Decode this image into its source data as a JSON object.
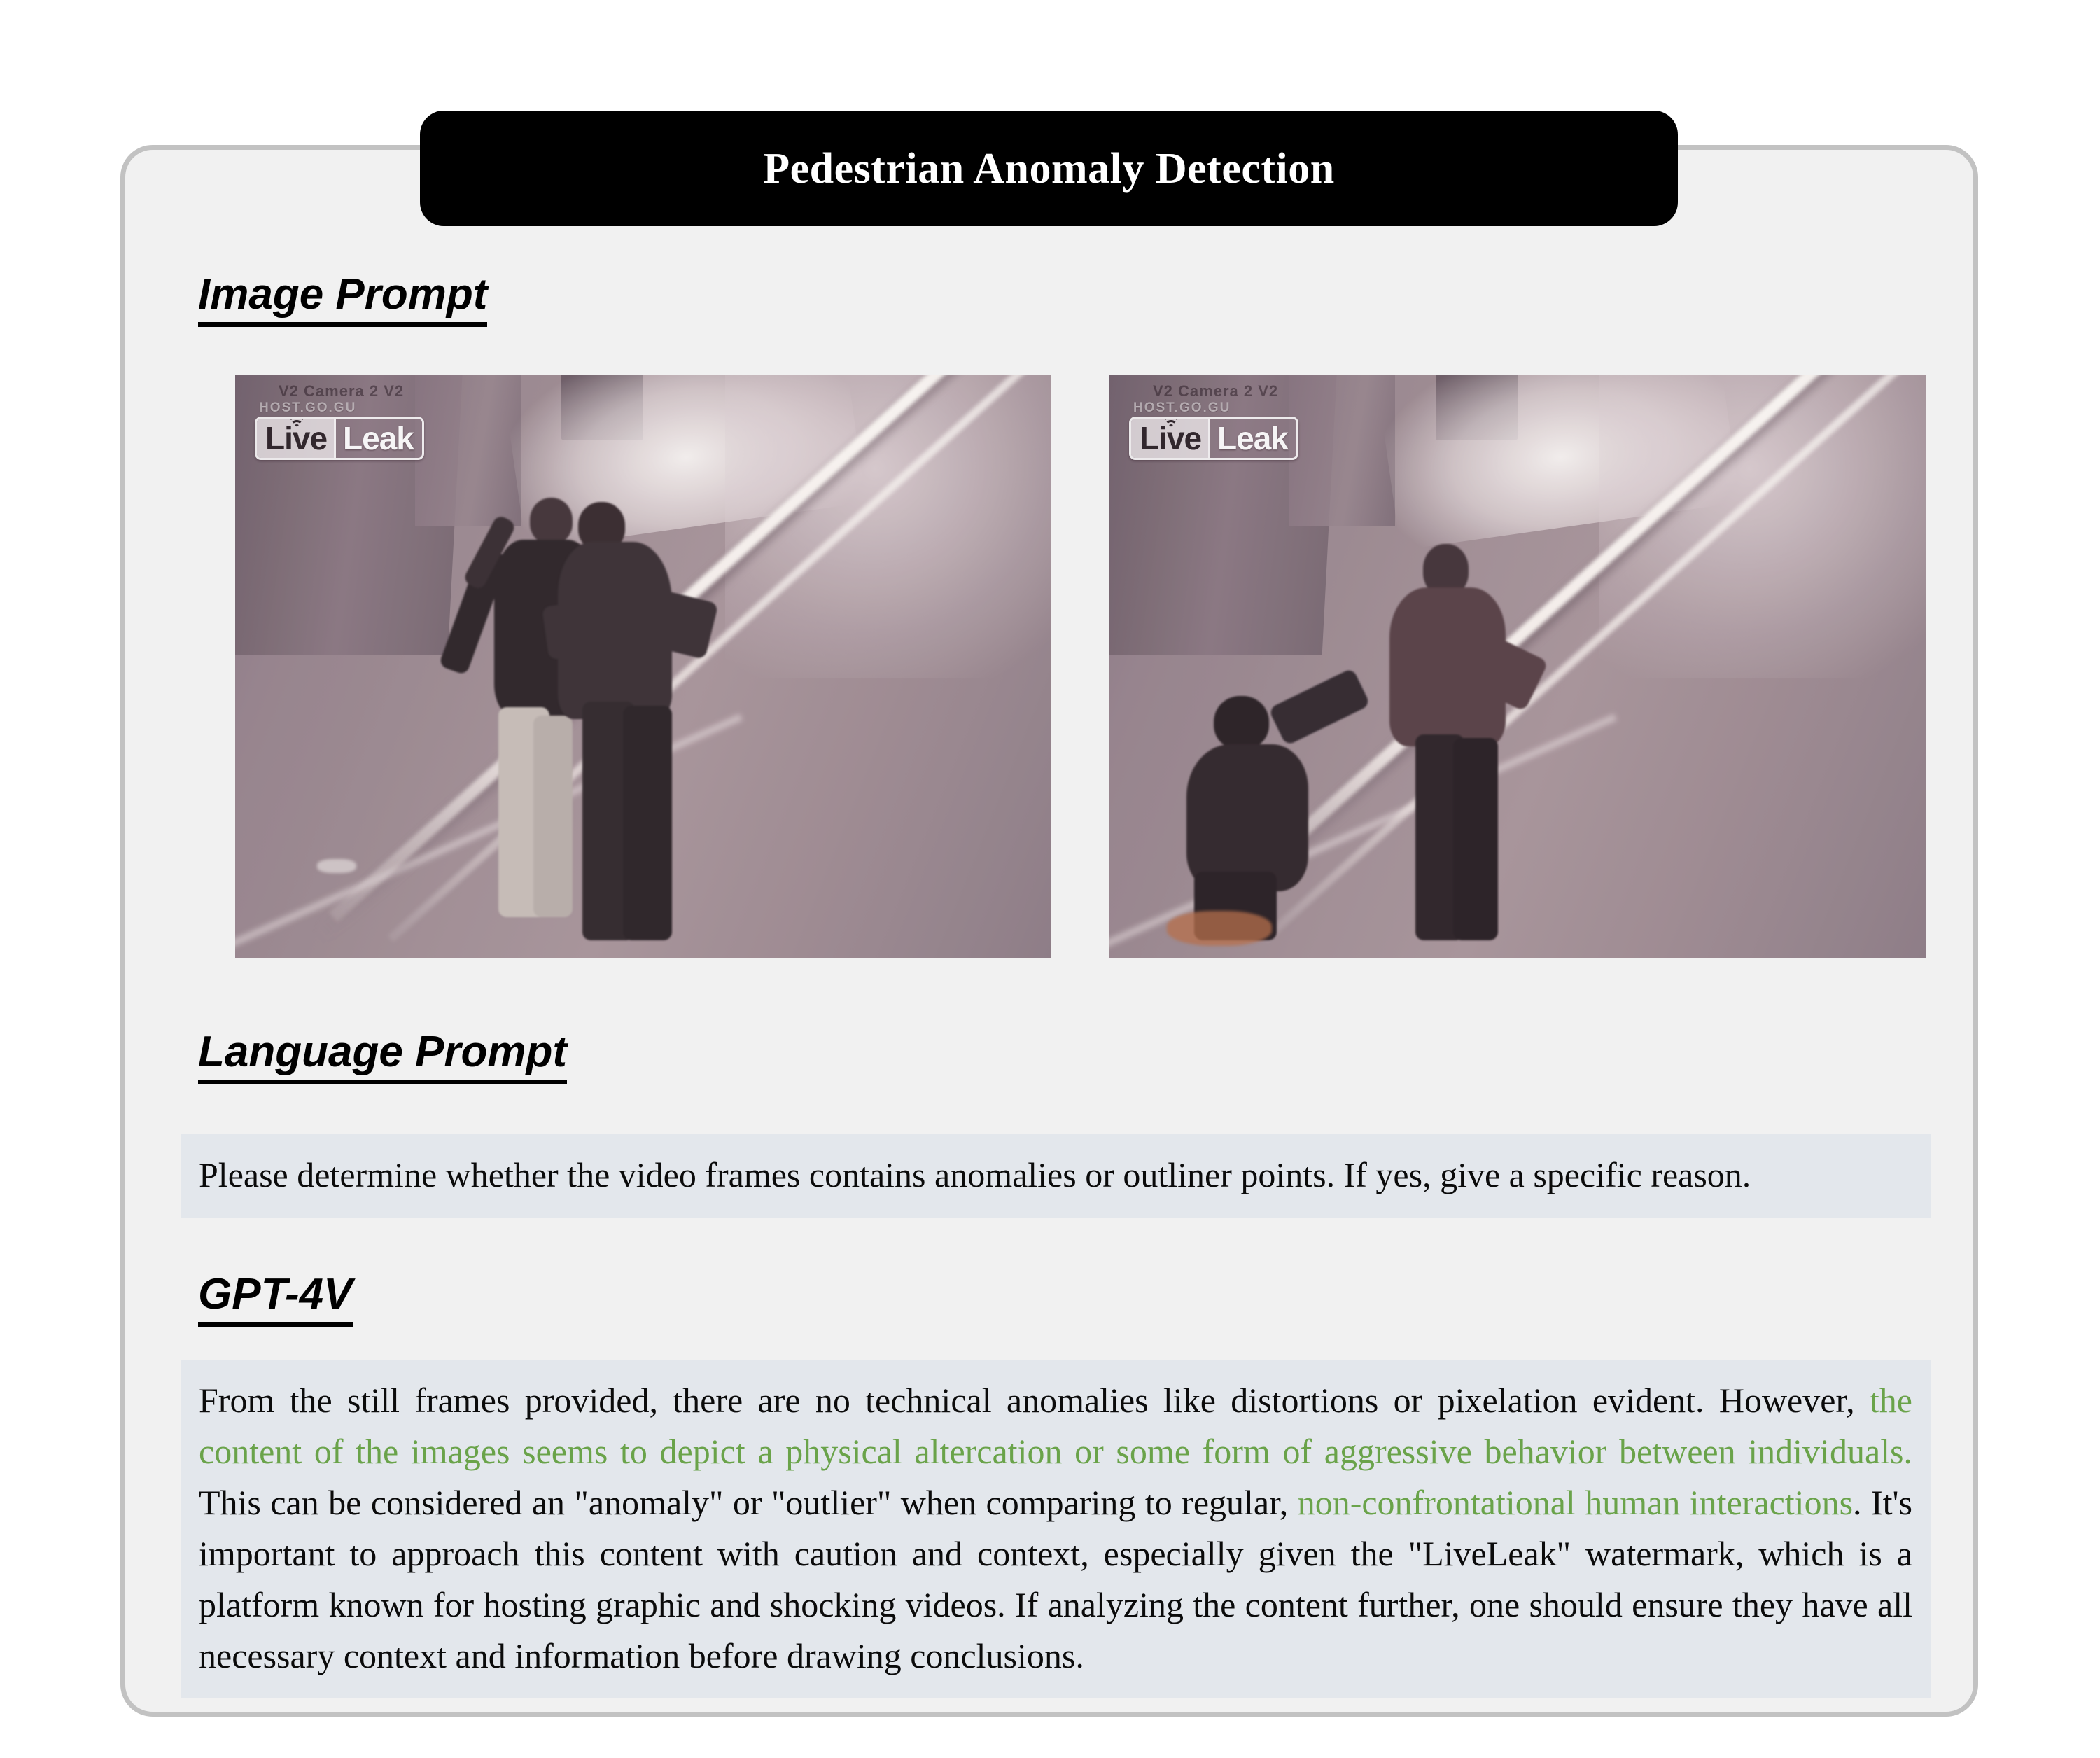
{
  "banner": {
    "title": "Pedestrian Anomaly Detection"
  },
  "sections": {
    "image_prompt_heading": "Image Prompt",
    "language_prompt_heading": "Language Prompt",
    "gpt4v_heading": "GPT-4V"
  },
  "image_prompt": {
    "frames": [
      {
        "label": "surveillance-frame-1",
        "watermark_live": "Live",
        "watermark_leak": "Leak",
        "watermark_host": "HOST.GO.GU",
        "watermark_camera": "V2 Camera 2  V2"
      },
      {
        "label": "surveillance-frame-2",
        "watermark_live": "Live",
        "watermark_leak": "Leak",
        "watermark_host": "HOST.GO.GU",
        "watermark_camera": "V2 Camera 2  V2"
      }
    ]
  },
  "language_prompt": {
    "text": "Please determine whether the video frames contains anomalies or outliner points. If yes, give a specific reason."
  },
  "gpt4v_response": {
    "part1": "From the still frames provided, there are no technical anomalies like distortions or pixelation evident. However, ",
    "highlight1": "the content of the images seems to depict a physical altercation or some form of aggressive behavior between individuals.",
    "part2": " This can be considered an \"anomaly\" or \"outlier\" when comparing to regular, ",
    "highlight2": "non-confrontational human interactions",
    "part3": ". It's important to approach this content with caution and context, especially given the \"LiveLeak\" watermark, which is a platform known for hosting graphic and shocking videos. If analyzing the content further, one should ensure they have all necessary context and information before drawing conclusions."
  },
  "colors": {
    "banner_background": "#000000",
    "banner_text": "#ffffff",
    "card_background": "#f1f1f1",
    "card_border": "#c2c2c2",
    "text_block_background": "#e3e7ec",
    "highlight_green": "#6aa34a",
    "body_text": "#0b0b0b"
  }
}
